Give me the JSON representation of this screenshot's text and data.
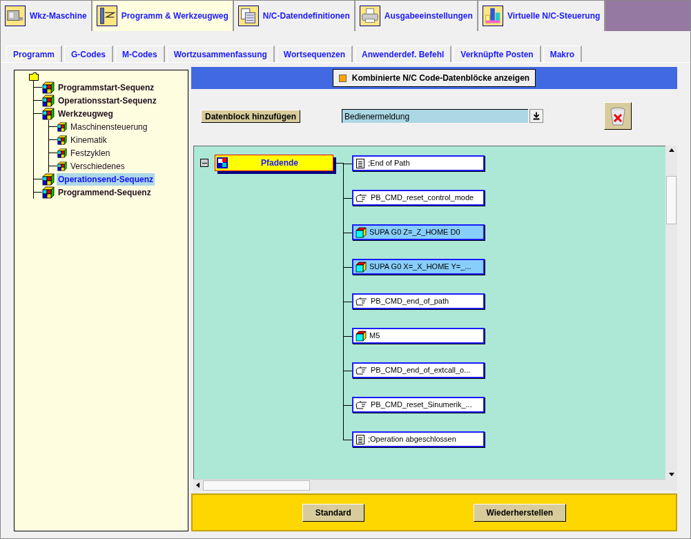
{
  "main_tabs": [
    {
      "label": "Wkz-Maschine",
      "selected": false
    },
    {
      "label": "Programm & Werkzeugweg",
      "selected": true
    },
    {
      "label": "N/C-Datendefinitionen",
      "selected": false
    },
    {
      "label": "Ausgabeeinstellungen",
      "selected": false
    },
    {
      "label": "Virtuelle N/C-Steuerung",
      "selected": false
    }
  ],
  "sub_tabs": [
    {
      "label": "Programm",
      "selected": true
    },
    {
      "label": "G-Codes",
      "selected": false
    },
    {
      "label": "M-Codes",
      "selected": false
    },
    {
      "label": "Wortzusammenfassung",
      "selected": false
    },
    {
      "label": "Wortsequenzen",
      "selected": false
    },
    {
      "label": "Anwenderdef. Befehl",
      "selected": false
    },
    {
      "label": "Verknüpfte Posten",
      "selected": false
    },
    {
      "label": "Makro",
      "selected": false
    }
  ],
  "tree": {
    "children": [
      {
        "label": "Programmstart-Sequenz",
        "selected": false
      },
      {
        "label": "Operationsstart-Sequenz",
        "selected": false
      },
      {
        "label": "Werkzeugweg",
        "selected": false,
        "children": [
          {
            "label": "Maschinensteuerung",
            "selected": false
          },
          {
            "label": "Kinematik",
            "selected": false
          },
          {
            "label": "Festzyklen",
            "selected": false
          },
          {
            "label": "Verschiedenes",
            "selected": false
          }
        ]
      },
      {
        "label": "Operationsend-Sequenz",
        "selected": true
      },
      {
        "label": "Programmend-Sequenz",
        "selected": false
      }
    ]
  },
  "combined_toggle": {
    "label": "Kombinierte N/C Code-Datenblöcke anzeigen",
    "checked": false
  },
  "add_block_button": "Datenblock hinzufügen",
  "block_type_select": {
    "value": "Bedienermeldung"
  },
  "canvas": {
    "node": {
      "label": "Pfadende",
      "expanded": true
    },
    "blocks": [
      {
        "kind": "comment",
        "label": ";End of Path",
        "selected": false
      },
      {
        "kind": "command",
        "label": "PB_CMD_reset_control_mode",
        "selected": false
      },
      {
        "kind": "code",
        "label": "SUPA G0 Z=_Z_HOME D0",
        "selected": true
      },
      {
        "kind": "code",
        "label": "SUPA G0 X=_X_HOME Y=_...",
        "selected": true
      },
      {
        "kind": "command",
        "label": "PB_CMD_end_of_path",
        "selected": false
      },
      {
        "kind": "code",
        "label": "M5",
        "selected": false
      },
      {
        "kind": "command",
        "label": "PB_CMD_end_of_extcall_o...",
        "selected": false
      },
      {
        "kind": "command",
        "label": "PB_CMD_reset_Sinumerik_...",
        "selected": false
      },
      {
        "kind": "comment",
        "label": ";Operation abgeschlossen",
        "selected": false
      }
    ]
  },
  "footer_buttons": [
    "Standard",
    "Wiederherstellen"
  ]
}
